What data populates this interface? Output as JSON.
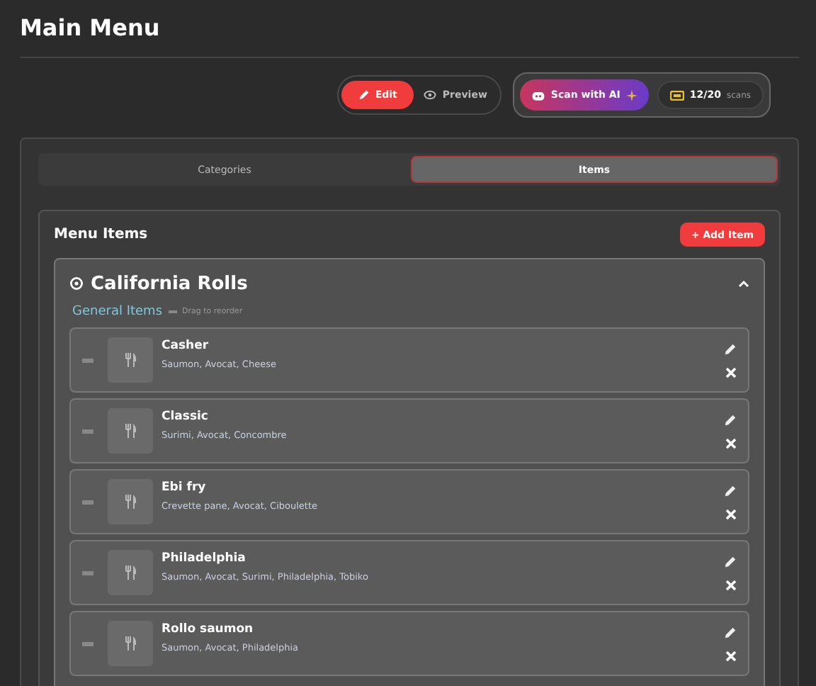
{
  "title": "Main Menu",
  "modes": [
    {
      "label": "Edit",
      "selected": true
    },
    {
      "label": "Preview",
      "selected": false
    }
  ],
  "scan_button": {
    "label": "Scan with AI"
  },
  "scan_quota": {
    "count": "12/20",
    "unit": "scans"
  },
  "tabs": [
    {
      "label": "Categories",
      "selected": false
    },
    {
      "label": "Items",
      "selected": true
    }
  ],
  "section": {
    "title": "Menu Items",
    "add_button": "+ Add Item"
  },
  "category": {
    "name": "California Rolls",
    "expanded": true,
    "group": "General Items",
    "hint": "Drag to reorder",
    "items": [
      {
        "name": "Casher",
        "ingredients": "Saumon, Avocat, Cheese"
      },
      {
        "name": "Classic",
        "ingredients": "Surimi, Avocat, Concombre"
      },
      {
        "name": "Ebi fry",
        "ingredients": "Crevette pane, Avocat, Ciboulette"
      },
      {
        "name": "Philadelphia",
        "ingredients": "Saumon, Avocat, Surimi, Philadelphia, Tobiko"
      },
      {
        "name": "Rollo saumon",
        "ingredients": "Saumon, Avocat, Philadelphia"
      }
    ]
  }
}
